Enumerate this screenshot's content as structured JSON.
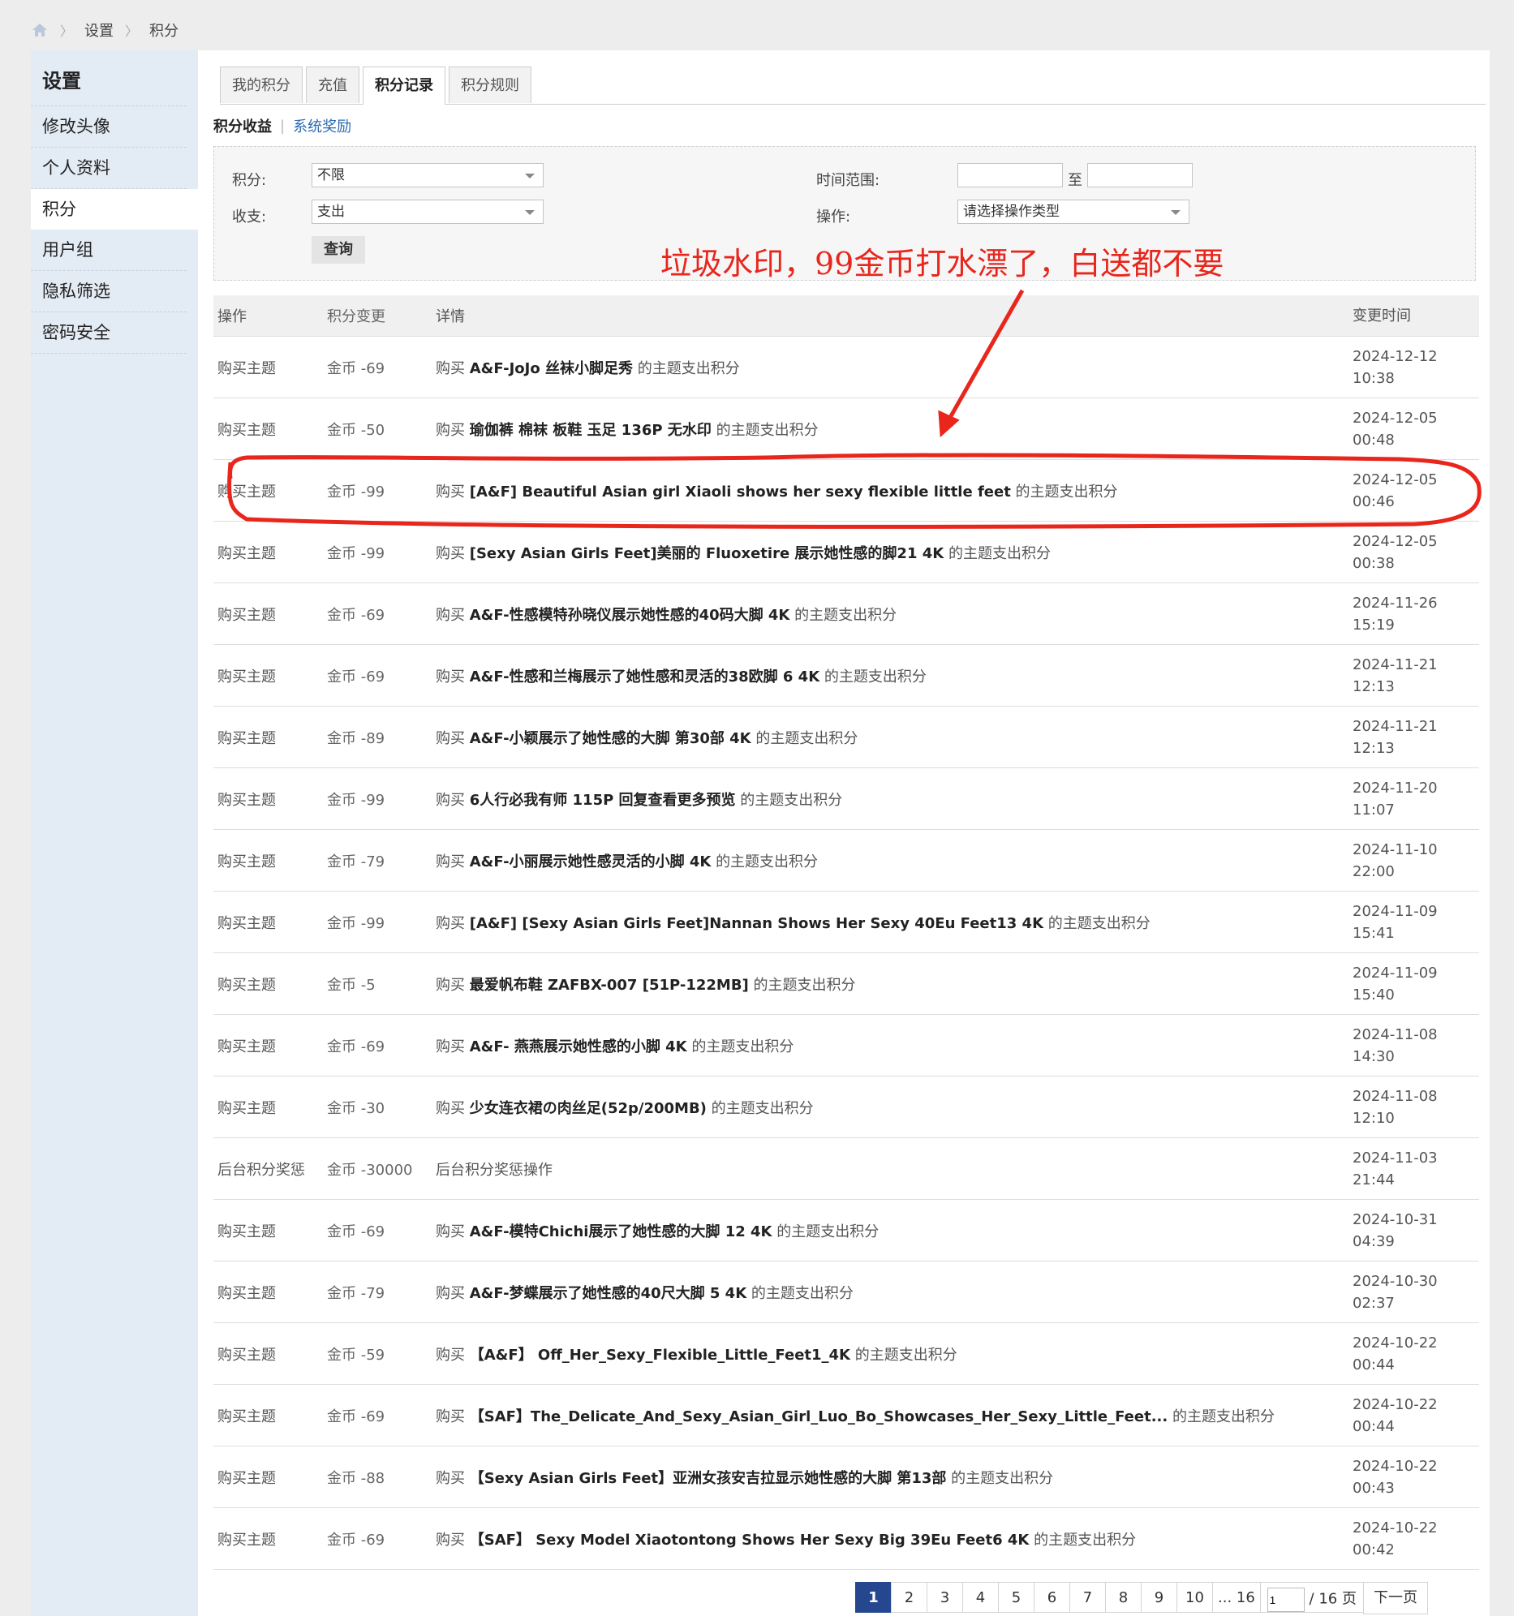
{
  "breadcrumb": {
    "items": [
      "设置",
      "积分"
    ]
  },
  "sidebar": {
    "title": "设置",
    "items": [
      {
        "label": "修改头像",
        "active": false
      },
      {
        "label": "个人资料",
        "active": false
      },
      {
        "label": "积分",
        "active": true
      },
      {
        "label": "用户组",
        "active": false
      },
      {
        "label": "隐私筛选",
        "active": false
      },
      {
        "label": "密码安全",
        "active": false
      }
    ]
  },
  "tabs": [
    {
      "label": "我的积分",
      "active": false
    },
    {
      "label": "充值",
      "active": false
    },
    {
      "label": "积分记录",
      "active": true
    },
    {
      "label": "积分规则",
      "active": false
    }
  ],
  "subnav": {
    "current": "积分收益",
    "link": "系统奖励"
  },
  "filter": {
    "points_label": "积分:",
    "points_value": "不限",
    "direction_label": "收支:",
    "direction_value": "支出",
    "time_label": "时间范围:",
    "time_to": "至",
    "operation_label": "操作:",
    "operation_value": "请选择操作类型",
    "query_label": "查询"
  },
  "annotation": {
    "text": "垃圾水印，99金币打水漂了，白送都不要",
    "color": "#e8261c"
  },
  "table": {
    "headers": [
      "操作",
      "积分变更",
      "详情",
      "变更时间"
    ],
    "rows": [
      {
        "op": "购买主题",
        "change": "金币 -69",
        "prefix": "购买",
        "title": "A&F-JoJo 丝袜小脚足秀",
        "suffix": "的主题支出积分",
        "date": "2024-12-12",
        "time": "10:38"
      },
      {
        "op": "购买主题",
        "change": "金币 -50",
        "prefix": "购买",
        "title": "瑜伽裤 棉袜 板鞋 玉足 136P 无水印",
        "suffix": "的主题支出积分",
        "date": "2024-12-05",
        "time": "00:48"
      },
      {
        "op": "购买主题",
        "change": "金币 -99",
        "prefix": "购买",
        "title": "[A&F] Beautiful Asian girl Xiaoli shows her sexy flexible little feet",
        "suffix": "的主题支出积分",
        "date": "2024-12-05",
        "time": "00:46"
      },
      {
        "op": "购买主题",
        "change": "金币 -99",
        "prefix": "购买",
        "title": "[Sexy Asian Girls Feet]美丽的 Fluoxetire 展示她性感的脚21 4K",
        "suffix": "的主题支出积分",
        "date": "2024-12-05",
        "time": "00:38"
      },
      {
        "op": "购买主题",
        "change": "金币 -69",
        "prefix": "购买",
        "title": "A&F-性感模特孙晓仪展示她性感的40码大脚 4K",
        "suffix": "的主题支出积分",
        "date": "2024-11-26",
        "time": "15:19"
      },
      {
        "op": "购买主题",
        "change": "金币 -69",
        "prefix": "购买",
        "title": "A&F-性感和兰梅展示了她性感和灵活的38欧脚 6 4K",
        "suffix": "的主题支出积分",
        "date": "2024-11-21",
        "time": "12:13"
      },
      {
        "op": "购买主题",
        "change": "金币 -89",
        "prefix": "购买",
        "title": "A&F-小颖展示了她性感的大脚 第30部 4K",
        "suffix": "的主题支出积分",
        "date": "2024-11-21",
        "time": "12:13"
      },
      {
        "op": "购买主题",
        "change": "金币 -99",
        "prefix": "购买",
        "title": "6人行必我有师 115P 回复查看更多预览",
        "suffix": "的主题支出积分",
        "date": "2024-11-20",
        "time": "11:07"
      },
      {
        "op": "购买主题",
        "change": "金币 -79",
        "prefix": "购买",
        "title": "A&F-小丽展示她性感灵活的小脚 4K",
        "suffix": "的主题支出积分",
        "date": "2024-11-10",
        "time": "22:00"
      },
      {
        "op": "购买主题",
        "change": "金币 -99",
        "prefix": "购买",
        "title": "[A&F] [Sexy Asian Girls Feet]Nannan Shows Her Sexy 40Eu Feet13 4K",
        "suffix": "的主题支出积分",
        "date": "2024-11-09",
        "time": "15:41"
      },
      {
        "op": "购买主题",
        "change": "金币 -5",
        "prefix": "购买",
        "title": "最爱帆布鞋 ZAFBX-007 [51P-122MB]",
        "suffix": "的主题支出积分",
        "date": "2024-11-09",
        "time": "15:40"
      },
      {
        "op": "购买主题",
        "change": "金币 -69",
        "prefix": "购买",
        "title": "A&F- 燕燕展示她性感的小脚 4K",
        "suffix": "的主题支出积分",
        "date": "2024-11-08",
        "time": "14:30"
      },
      {
        "op": "购买主题",
        "change": "金币 -30",
        "prefix": "购买",
        "title": "少女连衣裙の肉丝足(52p/200MB)",
        "suffix": "的主题支出积分",
        "date": "2024-11-08",
        "time": "12:10"
      },
      {
        "op": "后台积分奖惩",
        "change": "金币 -30000",
        "prefix": "后台积分奖惩操作",
        "title": "",
        "suffix": "",
        "date": "2024-11-03",
        "time": "21:44"
      },
      {
        "op": "购买主题",
        "change": "金币 -69",
        "prefix": "购买",
        "title": "A&F-模特Chichi展示了她性感的大脚 12 4K",
        "suffix": "的主题支出积分",
        "date": "2024-10-31",
        "time": "04:39"
      },
      {
        "op": "购买主题",
        "change": "金币 -79",
        "prefix": "购买",
        "title": "A&F-梦蝶展示了她性感的40尺大脚 5 4K",
        "suffix": "的主题支出积分",
        "date": "2024-10-30",
        "time": "02:37"
      },
      {
        "op": "购买主题",
        "change": "金币 -59",
        "prefix": "购买",
        "title": "【A&F】 Off_Her_Sexy_Flexible_Little_Feet1_4K",
        "suffix": "的主题支出积分",
        "date": "2024-10-22",
        "time": "00:44"
      },
      {
        "op": "购买主题",
        "change": "金币 -69",
        "prefix": "购买",
        "title": "【SAF】The_Delicate_And_Sexy_Asian_Girl_Luo_Bo_Showcases_Her_Sexy_Little_Feet...",
        "suffix": "的主题支出积分",
        "date": "2024-10-22",
        "time": "00:44"
      },
      {
        "op": "购买主题",
        "change": "金币 -88",
        "prefix": "购买",
        "title": "【Sexy Asian Girls Feet】亚洲女孩安吉拉显示她性感的大脚 第13部",
        "suffix": "的主题支出积分",
        "date": "2024-10-22",
        "time": "00:43"
      },
      {
        "op": "购买主题",
        "change": "金币 -69",
        "prefix": "购买",
        "title": "【SAF】 Sexy Model Xiaotontong Shows Her Sexy Big 39Eu Feet6 4K",
        "suffix": "的主题支出积分",
        "date": "2024-10-22",
        "time": "00:42"
      }
    ]
  },
  "pagination": {
    "current": "1",
    "pages": [
      "2",
      "3",
      "4",
      "5",
      "6",
      "7",
      "8",
      "9",
      "10"
    ],
    "ellipsis": "... 16",
    "input_value": "1",
    "total": "/ 16 页",
    "next": "下一页"
  },
  "colors": {
    "accent": "#24478f",
    "link": "#2b6cb0",
    "sidebar_bg": "#e3ebf4",
    "annotation": "#e8261c"
  }
}
